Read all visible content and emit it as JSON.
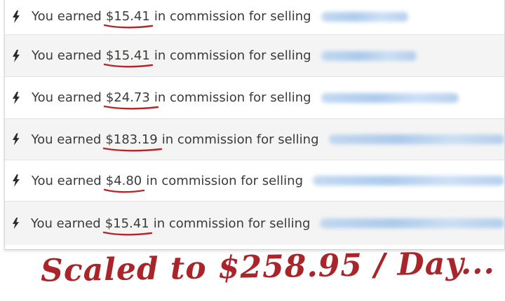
{
  "feed": {
    "rows": [
      {
        "prefix": "You earned",
        "amount": "$15.41",
        "suffix": "in commission for selling"
      },
      {
        "prefix": "You earned",
        "amount": "$15.41",
        "suffix": "in commission for selling"
      },
      {
        "prefix": "You earned",
        "amount": "$24.73",
        "suffix": "in commission for selling"
      },
      {
        "prefix": "You earned",
        "amount": "$183.19",
        "suffix": "in commission for selling"
      },
      {
        "prefix": "You earned",
        "amount": "$4.80",
        "suffix": "in commission for selling"
      },
      {
        "prefix": "You earned",
        "amount": "$15.41",
        "suffix": "in commission for selling"
      }
    ],
    "icon": "lightning-bolt-icon"
  },
  "caption": {
    "text": "Scaled to $258.95 / Day..."
  },
  "colors": {
    "underline": "#b3262a",
    "caption": "#a8262a",
    "alt_row": "#f4f4f4",
    "blur": "#a9c8ec"
  }
}
